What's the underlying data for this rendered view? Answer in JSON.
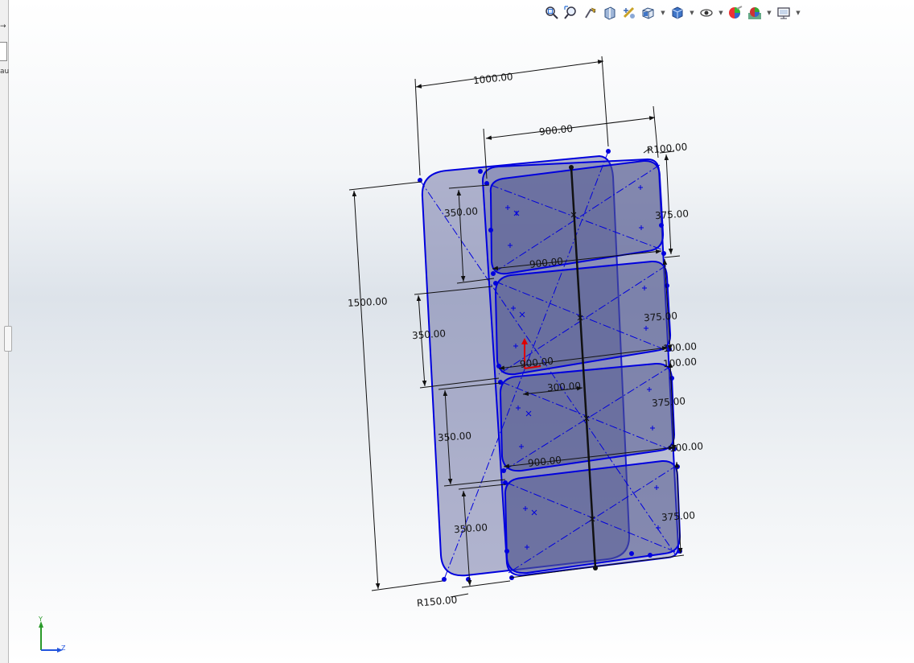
{
  "left_panel": {
    "arrow": "→",
    "fragment": "au"
  },
  "toolbar": {
    "items": [
      {
        "name": "zoom-to-fit-icon"
      },
      {
        "name": "zoom-to-area-icon"
      },
      {
        "name": "previous-view-icon"
      },
      {
        "name": "section-view-icon"
      },
      {
        "name": "dynamic-annotation-icon"
      },
      {
        "name": "view-orientation-icon",
        "dropdown": true
      },
      {
        "name": "display-style-icon",
        "dropdown": true
      },
      {
        "name": "hide-show-items-icon",
        "dropdown": true
      },
      {
        "name": "edit-appearance-icon"
      },
      {
        "name": "apply-scene-icon",
        "dropdown": true
      },
      {
        "name": "view-settings-icon",
        "dropdown": true
      }
    ]
  },
  "sketch": {
    "dimensions": {
      "overall_width": "1000.00",
      "inner_width_top": "900.00",
      "radius_top": "R100.00",
      "overall_height": "1500.00",
      "slot1_height": "350.00",
      "slot1_right": "375.00",
      "slot1_width": "900.00",
      "slot2_height": "350.00",
      "slot2_right": "375.00",
      "gap1": "100.00",
      "gap2": "100.00",
      "slot2_width": "900.00",
      "center_offset": "300.00",
      "slot3_height": "350.00",
      "slot3_right": "375.00",
      "gap3": "100.00",
      "slot3_width": "900.00",
      "slot4_height": "350.00",
      "slot4_right": "375.00",
      "radius_bottom": "R150.00"
    }
  },
  "triad": {
    "y": "Y",
    "z": "Z"
  },
  "colors": {
    "sketch_line": "#0000dd",
    "fill": "#5a5f9a",
    "dimension": "#111111"
  }
}
